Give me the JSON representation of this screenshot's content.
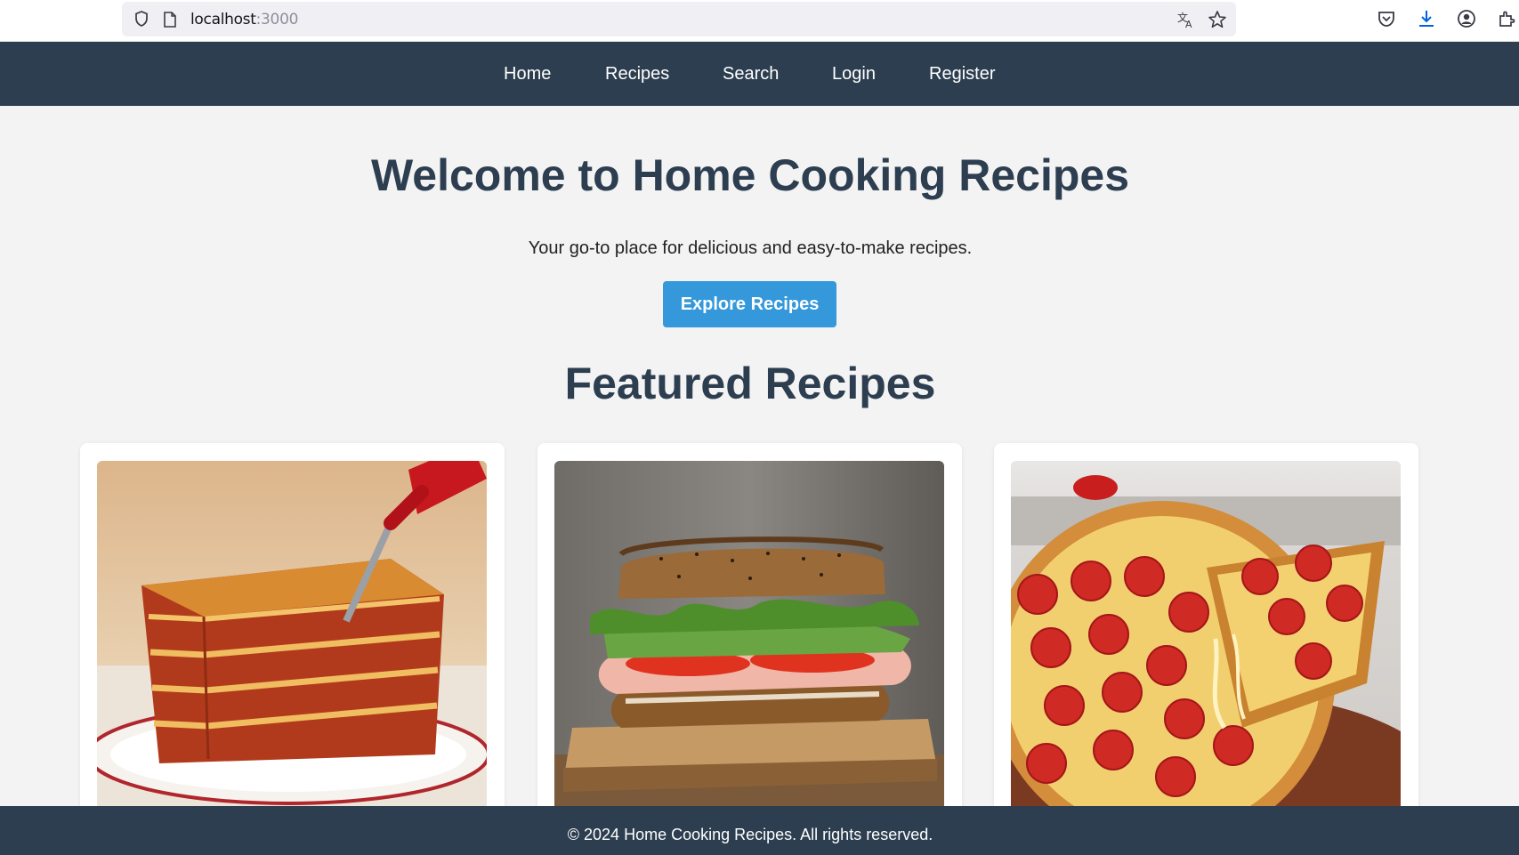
{
  "browser": {
    "url_host": "localhost",
    "url_port": ":3000"
  },
  "nav": {
    "items": [
      {
        "label": "Home"
      },
      {
        "label": "Recipes"
      },
      {
        "label": "Search"
      },
      {
        "label": "Login"
      },
      {
        "label": "Register"
      }
    ]
  },
  "hero": {
    "title": "Welcome to Home Cooking Recipes",
    "subtitle": "Your go-to place for delicious and easy-to-make recipes.",
    "button_label": "Explore Recipes"
  },
  "featured": {
    "title": "Featured Recipes",
    "cards": [
      {
        "image": "lasagna-image"
      },
      {
        "image": "sandwich-image"
      },
      {
        "image": "pepperoni-pizza-image"
      }
    ]
  },
  "footer": {
    "text": "© 2024 Home Cooking Recipes. All rights reserved."
  },
  "colors": {
    "navbar": "#2c3e50",
    "accent": "#3498db",
    "background": "#f3f3f3"
  }
}
